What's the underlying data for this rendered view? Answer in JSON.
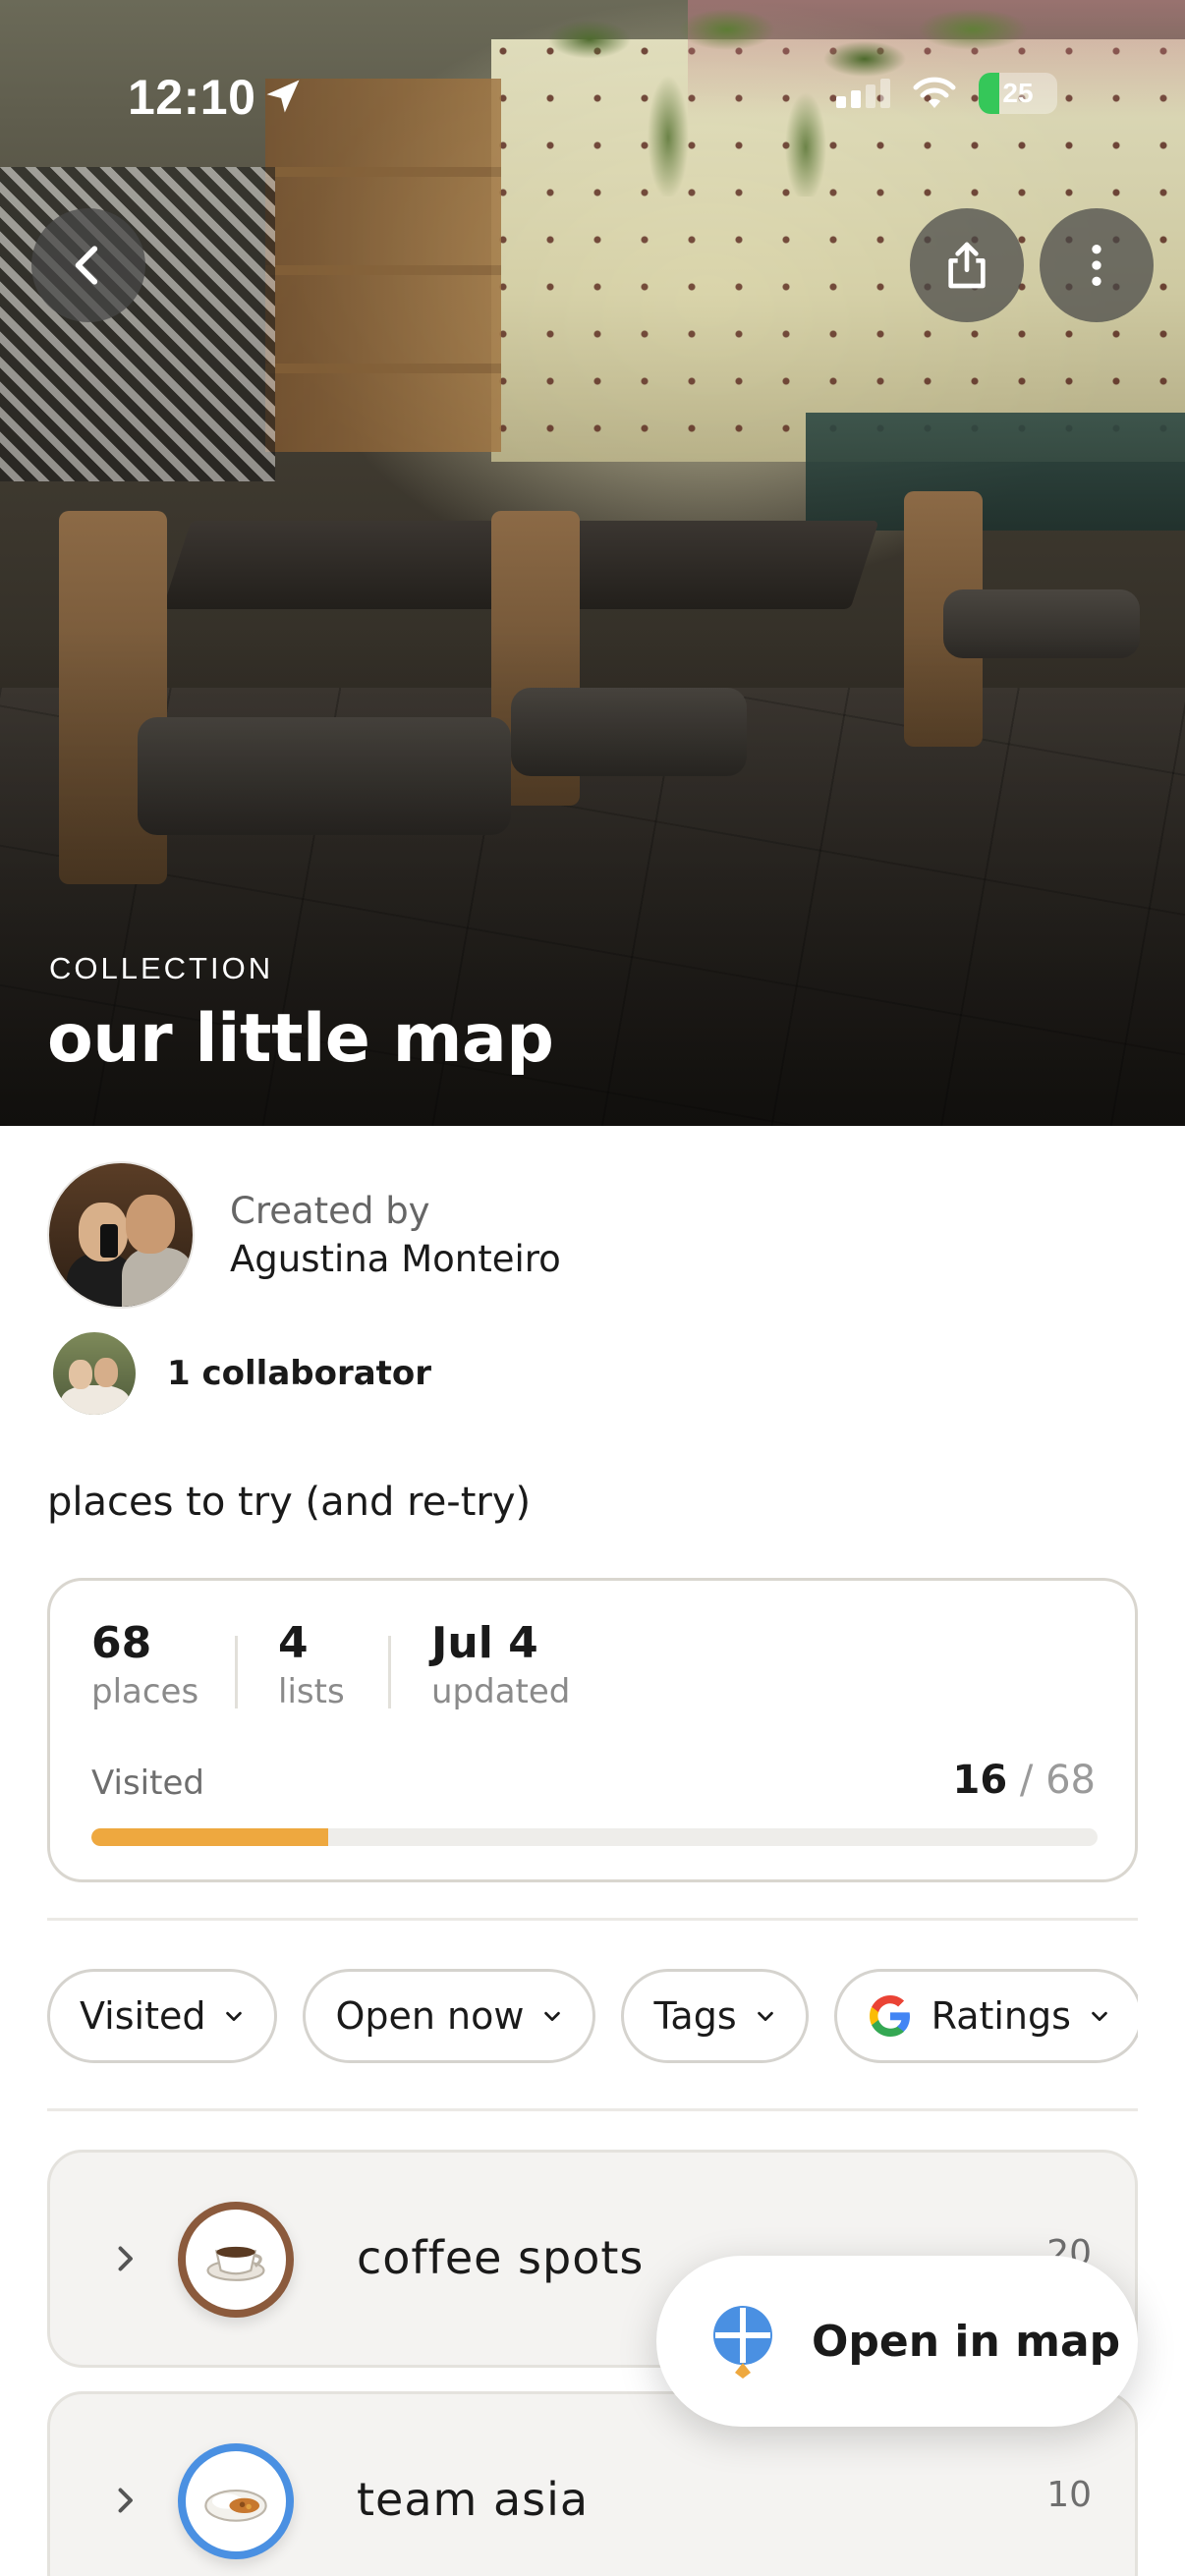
{
  "status_bar": {
    "time": "12:10",
    "battery": "25"
  },
  "hero": {
    "kicker": "COLLECTION",
    "title": "our little map"
  },
  "creator": {
    "label": "Created by",
    "name": "Agustina Monteiro"
  },
  "collaborators": {
    "text": "1 collaborator"
  },
  "description": "places to try (and re-try)",
  "stats": {
    "places_value": "68",
    "places_label": "places",
    "lists_value": "4",
    "lists_label": "lists",
    "updated_value": "Jul 4",
    "updated_label": "updated",
    "visited_label": "Visited",
    "visited_count": "16",
    "visited_total": "/ 68",
    "visited_fraction": 0.235
  },
  "filters": [
    {
      "label": "Visited",
      "icon": "chevron-down-icon"
    },
    {
      "label": "Open now",
      "icon": "chevron-down-icon"
    },
    {
      "label": "Tags",
      "icon": "chevron-down-icon"
    },
    {
      "label": "Ratings",
      "icon": "google-icon"
    }
  ],
  "lists": [
    {
      "name": "coffee spots",
      "count": "20",
      "icon": "coffee-cup-icon",
      "ring": "#8b5a3c"
    },
    {
      "name": "team asia",
      "count": "10",
      "icon": "curry-bowl-icon",
      "ring": "#4a90e2"
    }
  ],
  "open_map": {
    "label": "Open in map"
  },
  "colors": {
    "progress": "#eea83f",
    "accent_blue": "#4a90e2"
  }
}
